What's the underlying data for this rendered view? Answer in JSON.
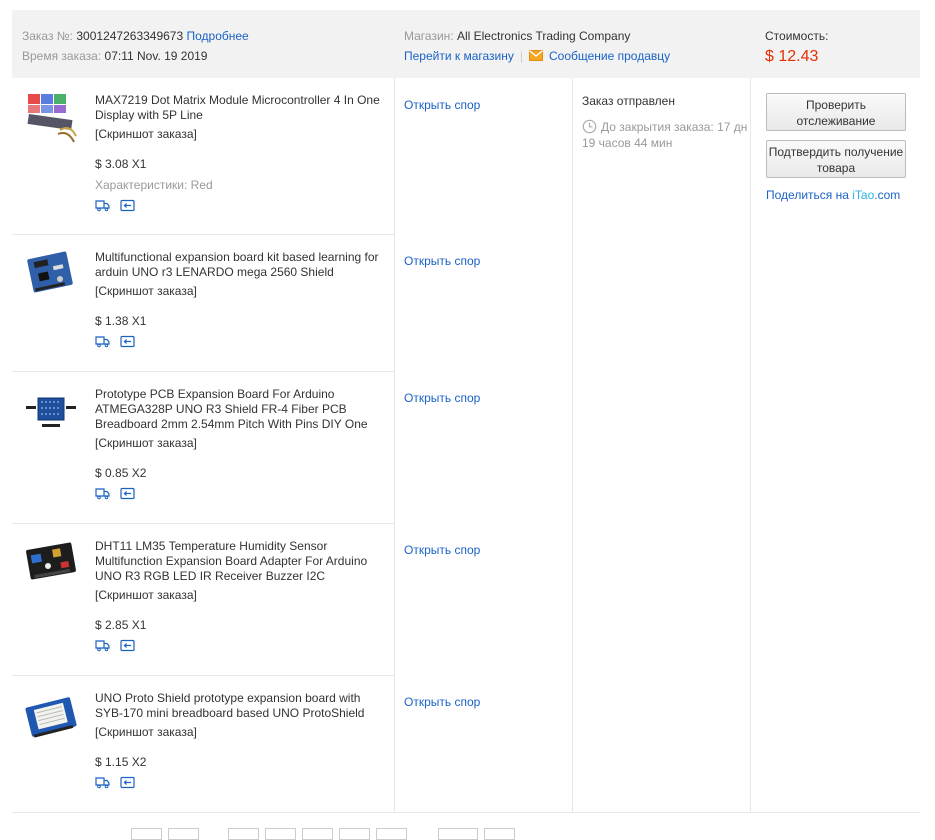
{
  "header": {
    "order_label": "Заказ №:",
    "order_number": "3001247263349673",
    "details_link": "Подробнее",
    "time_label": "Время заказа:",
    "time_value": "07:11 Nov. 19 2019",
    "store_label": "Магазин:",
    "store_name": "All Electronics Trading Company",
    "go_to_store": "Перейти к магазину",
    "separator": "|",
    "message_seller": "Сообщение продавцу",
    "cost_label": "Стоимость:",
    "cost_value": "$ 12.43"
  },
  "items": [
    {
      "title": "MAX7219 Dot Matrix Module Microcontroller 4 In One Display with 5P Line",
      "snapshot": "[Скриншот заказа]",
      "price": "$ 3.08 X1",
      "attributes": "Характеристики: Red",
      "dispute": "Открыть спор"
    },
    {
      "title": "Multifunctional expansion board kit based learning for arduin UNO r3 LENARDO mega 2560 Shield",
      "snapshot": "[Скриншот заказа]",
      "price": "$ 1.38 X1",
      "dispute": "Открыть спор"
    },
    {
      "title": "Prototype PCB Expansion Board For Arduino ATMEGA328P UNO R3 Shield FR-4 Fiber PCB Breadboard 2mm 2.54mm Pitch With Pins DIY One",
      "snapshot": "[Скриншот заказа]",
      "price": "$ 0.85 X2",
      "dispute": "Открыть спор"
    },
    {
      "title": "DHT11 LM35 Temperature Humidity Sensor Multifunction Expansion Board Adapter For Arduino UNO R3 RGB LED IR Receiver Buzzer I2C",
      "snapshot": "[Скриншот заказа]",
      "price": "$ 2.85 X1",
      "dispute": "Открыть спор"
    },
    {
      "title": "UNO Proto Shield prototype expansion board with SYB-170 mini breadboard based UNO ProtoShield",
      "snapshot": "[Скриншот заказа]",
      "price": "$ 1.15 X2",
      "dispute": "Открыть спор"
    }
  ],
  "status": {
    "title": "Заказ отправлен",
    "countdown": "До закрытия заказа: 17 дн 19 часов 44 мин"
  },
  "actions": {
    "track_button": "Проверить отслеживание",
    "confirm_button": "Подтвердить получение товара",
    "share_prefix": "Поделиться на ",
    "share_brand": "iTao",
    "share_suffix": ".com"
  },
  "icons": {
    "shipping": "truck-icon",
    "return": "return-card-icon",
    "mail": "envelope-icon",
    "clock": "clock-icon"
  },
  "colors": {
    "link": "#1a62c5",
    "price": "#e62e04",
    "header_bg": "#f2f2f2",
    "mail_icon": "#f5a623"
  }
}
